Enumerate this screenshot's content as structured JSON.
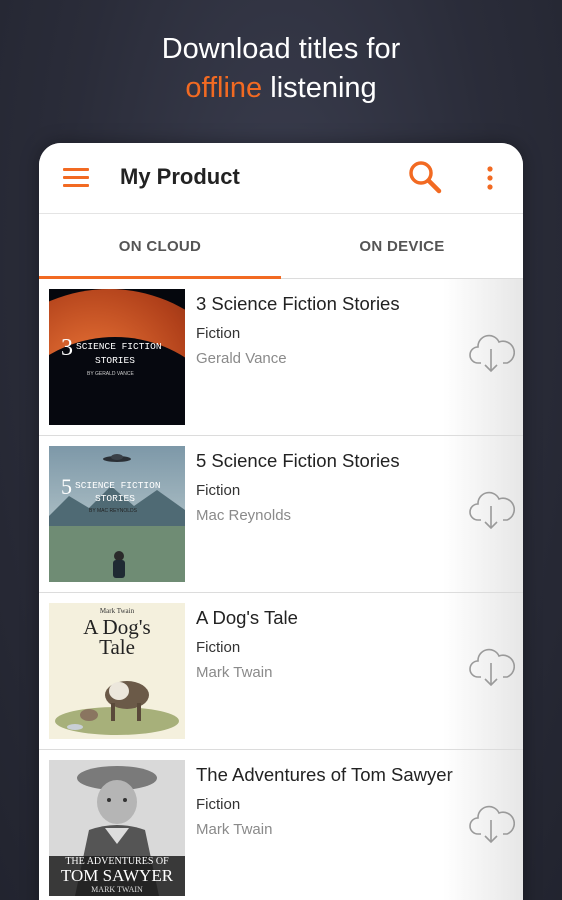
{
  "promo": {
    "line1": "Download titles for",
    "accent": "offline",
    "line2_rest": " listening"
  },
  "app": {
    "title": "My Product",
    "menu_icon": "hamburger-menu-icon",
    "search_icon": "search-icon",
    "more_icon": "more-vertical-icon"
  },
  "tabs": [
    {
      "label": "ON CLOUD",
      "active": true
    },
    {
      "label": "ON DEVICE",
      "active": false
    }
  ],
  "books": [
    {
      "title": "3 Science Fiction Stories",
      "genre": "Fiction",
      "author": "Gerald Vance",
      "cover_text": {
        "num": "3",
        "l1": "SCIENCE FICTION",
        "l2": "STORIES",
        "l3": "BY GERALD VANCE"
      }
    },
    {
      "title": "5 Science Fiction Stories",
      "genre": "Fiction",
      "author": "Mac Reynolds",
      "cover_text": {
        "num": "5",
        "l1": "SCIENCE FICTION",
        "l2": "STORIES",
        "l3": "BY MAC REYNOLDS"
      }
    },
    {
      "title": "A Dog's Tale",
      "genre": "Fiction",
      "author": "Mark Twain",
      "cover_text": {
        "top": "Mark Twain",
        "l1": "A Dog's",
        "l2": "Tale"
      }
    },
    {
      "title": "The Adventures of Tom Sawyer",
      "genre": "Fiction",
      "author": "Mark Twain",
      "cover_text": {
        "l1": "THE ADVENTURES OF",
        "l2": "TOM SAWYER",
        "l3": "MARK TWAIN"
      }
    }
  ],
  "download_icon": "cloud-download-icon",
  "colors": {
    "accent": "#f26a22",
    "background": "#2a2c39"
  }
}
